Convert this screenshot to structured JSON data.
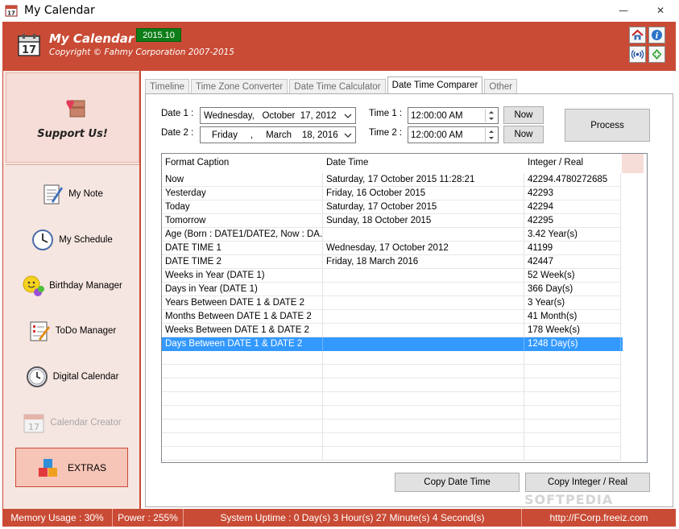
{
  "window": {
    "title": "My Calendar",
    "minimize": "—",
    "close": "✕"
  },
  "header": {
    "app_title": "My Calendar",
    "copyright": "Copyright © Fahmy Corporation 2007-2015",
    "version": "2015.10",
    "accent_color": "#c94b35",
    "buttons": [
      "home-icon",
      "info-icon",
      "broadcast-icon",
      "plus-icon"
    ]
  },
  "sidebar": {
    "support_label": "Support Us!",
    "items": [
      {
        "label": "My Note",
        "icon": "note-icon"
      },
      {
        "label": "My Schedule",
        "icon": "clock-icon"
      },
      {
        "label": "Birthday Manager",
        "icon": "smiley-icon"
      },
      {
        "label": "ToDo Manager",
        "icon": "todo-icon"
      },
      {
        "label": "Digital Calendar",
        "icon": "digital-clock-icon"
      },
      {
        "label": "Calendar Creator",
        "icon": "calendar-icon",
        "disabled": true
      }
    ],
    "extras_label": "EXTRAS"
  },
  "tabs": [
    "Timeline",
    "Time Zone Converter",
    "Date Time Calculator",
    "Date Time Comparer",
    "Other"
  ],
  "active_tab": "Date Time Comparer",
  "form": {
    "date1_label": "Date 1 :",
    "date1_value": "Wednesday,   October  17, 2012",
    "date2_label": "Date 2 :",
    "date2_value": "Friday     ,     March    18, 2016",
    "time1_label": "Time 1 :",
    "time1_value": "12:00:00 AM",
    "time2_label": "Time 2 :",
    "time2_value": "12:00:00 AM",
    "now_label": "Now",
    "process_label": "Process"
  },
  "grid": {
    "columns": [
      "Format Caption",
      "Date Time",
      "Integer / Real"
    ],
    "rows": [
      [
        "Now",
        "Saturday, 17 October 2015  11:28:21",
        "42294.4780272685"
      ],
      [
        "Yesterday",
        "Friday, 16 October 2015",
        "42293"
      ],
      [
        "Today",
        "Saturday, 17 October 2015",
        "42294"
      ],
      [
        "Tomorrow",
        "Sunday, 18 October 2015",
        "42295"
      ],
      [
        "Age (Born : DATE1/DATE2, Now : DA...",
        "",
        "3.42 Year(s)"
      ],
      [
        "DATE TIME 1",
        "Wednesday, 17 October 2012",
        "41199"
      ],
      [
        "DATE TIME 2",
        "Friday, 18 March 2016",
        "42447"
      ],
      [
        "Weeks in Year (DATE 1)",
        "",
        "52 Week(s)"
      ],
      [
        "Days in Year (DATE 1)",
        "",
        "366 Day(s)"
      ],
      [
        "Years Between DATE 1 & DATE 2",
        "",
        "3 Year(s)"
      ],
      [
        "Months Between DATE 1 & DATE 2",
        "",
        "41 Month(s)"
      ],
      [
        "Weeks Between DATE 1 & DATE 2",
        "",
        "178 Week(s)"
      ],
      [
        "Days Between DATE 1 & DATE 2",
        "",
        "1248 Day(s)"
      ]
    ],
    "selected_row": 12,
    "empty_rows": 8
  },
  "buttons": {
    "copy_date_time": "Copy Date Time",
    "copy_integer": "Copy Integer / Real"
  },
  "watermark": "SOFTPEDIA",
  "status": {
    "memory": "Memory Usage : 30%",
    "power": "Power : 255%",
    "uptime": "System Uptime : 0 Day(s) 3 Hour(s) 27 Minute(s) 4 Second(s)",
    "url": "http://FCorp.freeiz.com"
  }
}
